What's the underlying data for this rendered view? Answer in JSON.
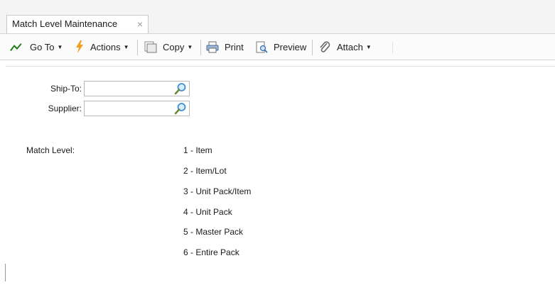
{
  "tab": {
    "title": "Match Level Maintenance",
    "close_glyph": "×"
  },
  "toolbar": {
    "goto_label": "Go To",
    "actions_label": "Actions",
    "copy_label": "Copy",
    "print_label": "Print",
    "preview_label": "Preview",
    "attach_label": "Attach",
    "caret": "▼"
  },
  "form": {
    "ship_to_label": "Ship-To:",
    "ship_to_value": "",
    "supplier_label": "Supplier:",
    "supplier_value": ""
  },
  "match_level": {
    "label": "Match Level:",
    "options": [
      "1 - Item",
      "2 - Item/Lot",
      "3 - Unit Pack/Item",
      "4 - Unit Pack",
      "5 - Master Pack",
      "6 - Entire Pack"
    ]
  },
  "colors": {
    "goto_icon": "#3a9a2e",
    "actions_icon": "#f0a020",
    "lookup_icon": "#3d8fd6"
  }
}
